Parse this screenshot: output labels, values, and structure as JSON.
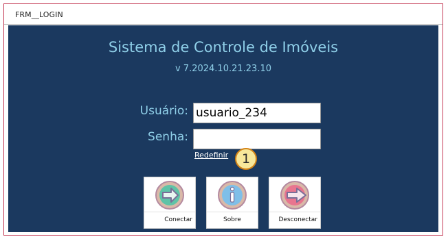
{
  "window": {
    "title": "FRM__LOGIN"
  },
  "header": {
    "app_title": "Sistema de Controle de Imóveis",
    "version": "v 7.2024.10.21.23.10"
  },
  "form": {
    "user_label": "Usuário:",
    "user_value": "usuario_234",
    "password_label": "Senha:",
    "password_value": "",
    "reset_link": "Redefinir"
  },
  "callout": {
    "number": "1"
  },
  "buttons": {
    "connect": {
      "label": "Conectar",
      "icon": "arrow-right-circle-icon"
    },
    "about": {
      "label": "Sobre",
      "icon": "info-icon"
    },
    "disconnect": {
      "label": "Desconectar",
      "icon": "logout-arrow-icon"
    }
  },
  "colors": {
    "panel_background": "#1b395f",
    "label_text": "#8fcfe8",
    "window_border": "#c43a55",
    "callout_fill": "#f7e79a",
    "callout_border": "#d38316"
  }
}
